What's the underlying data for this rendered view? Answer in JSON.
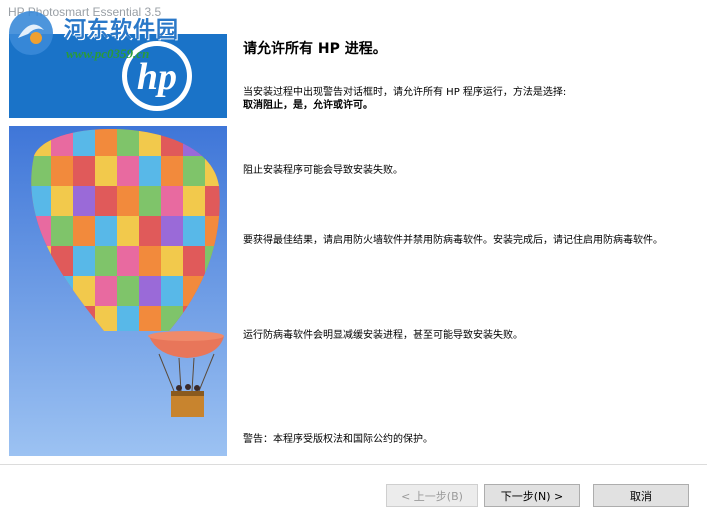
{
  "window": {
    "title": "HP Photosmart Essential 3.5"
  },
  "watermark": {
    "text": "河东软件园",
    "url": "www.pc0359.cn"
  },
  "page": {
    "heading": "请允许所有 HP 进程。",
    "para1_line1": "当安装过程中出现警告对话框时，请允许所有 HP 程序运行，方法是选择:",
    "para1_line2": "取消阻止，是，允许或许可。",
    "para2": "阻止安装程序可能会导致安装失败。",
    "para3": "要获得最佳结果，请启用防火墙软件并禁用防病毒软件。安装完成后，请记住启用防病毒软件。",
    "para4": "运行防病毒软件会明显减缓安装进程，甚至可能导致安装失败。",
    "para5": "警告：本程序受版权法和国际公约的保护。"
  },
  "buttons": {
    "back": "< 上一步(B)",
    "next": "下一步(N) >",
    "cancel": "取消"
  },
  "colors": {
    "hp_blue": "#1a73c8",
    "sky": "#6a9ee8"
  },
  "icons": {
    "hp_logo": "hp-logo",
    "balloon": "hot-air-balloon-image",
    "watermark_logo": "watermark-logo-icon"
  }
}
